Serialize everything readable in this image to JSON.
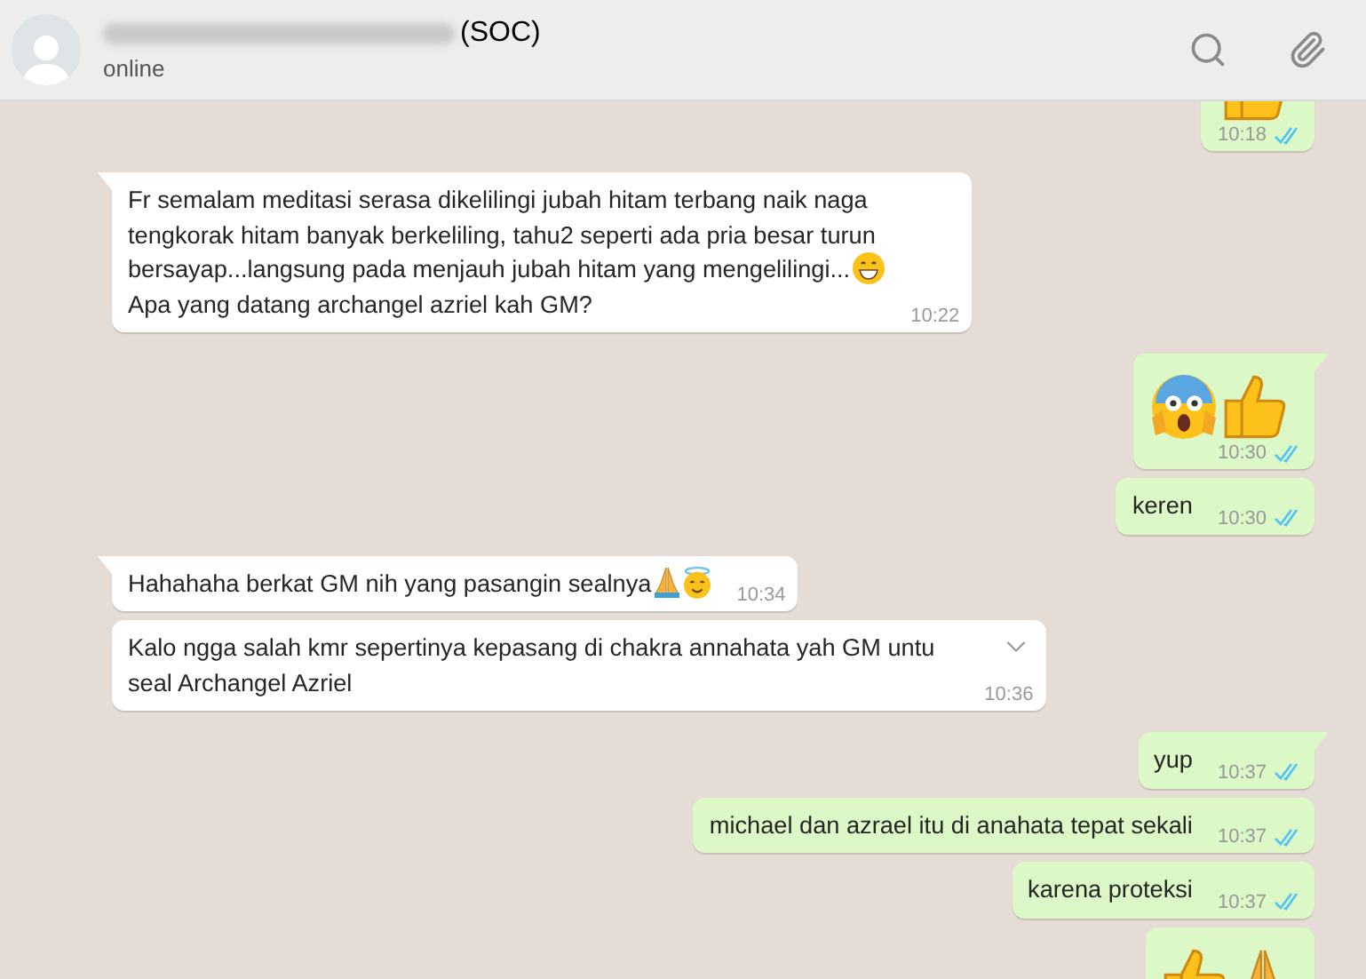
{
  "header": {
    "name_suffix": "(SOC)",
    "status": "online"
  },
  "messages": [
    {
      "outgoing": true,
      "tail": false,
      "kind": "emoji",
      "parts": [
        {
          "kind": "thumbs"
        }
      ],
      "time": "10:18",
      "read": true
    },
    {
      "outgoing": false,
      "tail": true,
      "kind": "text",
      "parts": [
        {
          "kind": "text",
          "text": "Fr semalam meditasi serasa dikelilingi jubah hitam terbang naik naga"
        },
        {
          "kind": "break"
        },
        {
          "kind": "text",
          "text": "tengkorak hitam banyak berkeliling, tahu2 seperti ada pria besar turun"
        },
        {
          "kind": "break"
        },
        {
          "kind": "text",
          "text": "bersayap...langsung pada menjauh jubah hitam yang mengelilingi..."
        },
        {
          "kind": "grin"
        },
        {
          "kind": "break"
        },
        {
          "kind": "text",
          "text": "Apa yang datang archangel azriel kah GM?"
        }
      ],
      "time": "10:22",
      "menu": false
    },
    {
      "outgoing": true,
      "tail": true,
      "kind": "emoji",
      "parts": [
        {
          "kind": "scream"
        },
        {
          "kind": "thumbs"
        }
      ],
      "time": "10:30",
      "read": true
    },
    {
      "outgoing": true,
      "tail": false,
      "kind": "text",
      "parts": [
        {
          "kind": "text",
          "text": "keren"
        }
      ],
      "time": "10:30",
      "read": true
    },
    {
      "outgoing": false,
      "tail": true,
      "kind": "text",
      "parts": [
        {
          "kind": "text",
          "text": "Hahahaha berkat GM nih yang pasangin sealnya"
        },
        {
          "kind": "pray"
        },
        {
          "kind": "halo"
        }
      ],
      "time": "10:34",
      "menu": false
    },
    {
      "outgoing": false,
      "tail": false,
      "kind": "text",
      "parts": [
        {
          "kind": "text",
          "text": "Kalo ngga salah kmr sepertinya kepasang di chakra annahata yah GM untu"
        },
        {
          "kind": "break"
        },
        {
          "kind": "text",
          "text": "seal Archangel Azriel"
        }
      ],
      "time": "10:36",
      "menu": true
    },
    {
      "outgoing": true,
      "tail": true,
      "kind": "text",
      "parts": [
        {
          "kind": "text",
          "text": "yup"
        }
      ],
      "time": "10:37",
      "read": true
    },
    {
      "outgoing": true,
      "tail": false,
      "kind": "text",
      "parts": [
        {
          "kind": "text",
          "text": "michael dan azrael itu di anahata tepat sekali"
        }
      ],
      "time": "10:37",
      "read": true
    },
    {
      "outgoing": true,
      "tail": false,
      "kind": "text",
      "parts": [
        {
          "kind": "text",
          "text": "karena proteksi"
        }
      ],
      "time": "10:37",
      "read": true
    },
    {
      "outgoing": true,
      "tail": false,
      "kind": "emoji",
      "parts": [
        {
          "kind": "thumbs"
        },
        {
          "kind": "pray"
        }
      ]
    }
  ]
}
